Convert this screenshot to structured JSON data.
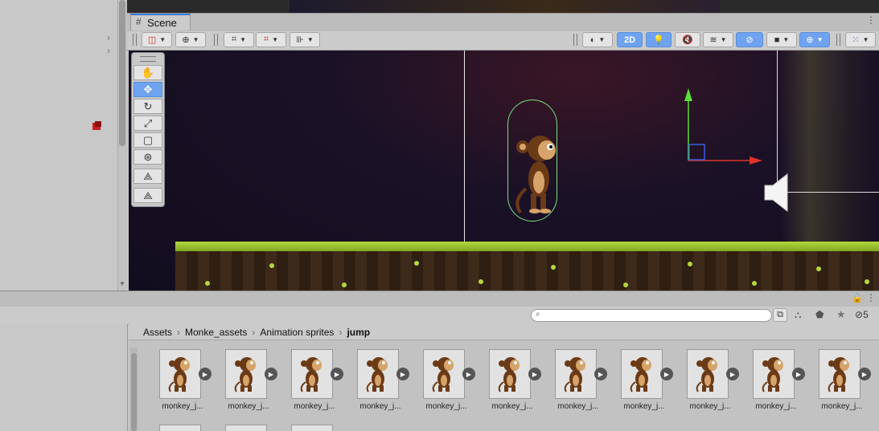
{
  "scene_tab": {
    "label": "Scene",
    "icon": "grid-icon"
  },
  "scene_toolbar": {
    "toggle_2d_label": "2D",
    "hidden_count": "5"
  },
  "project": {
    "search": {
      "placeholder": "",
      "value": ""
    },
    "breadcrumb": [
      "Assets",
      "Monke_assets",
      "Animation sprites",
      "jump"
    ],
    "hidden_count": "5",
    "assets": [
      {
        "label": "monkey_j..."
      },
      {
        "label": "monkey_j..."
      },
      {
        "label": "monkey_j..."
      },
      {
        "label": "monkey_j..."
      },
      {
        "label": "monkey_j..."
      },
      {
        "label": "monkey_j..."
      },
      {
        "label": "monkey_j..."
      },
      {
        "label": "monkey_j..."
      },
      {
        "label": "monkey_j..."
      },
      {
        "label": "monkey_j..."
      },
      {
        "label": "monkey_j..."
      }
    ]
  },
  "colors": {
    "accent": "#6fa3f0",
    "collider": "#7de07d",
    "gizmo_y": "#5ddc3a",
    "gizmo_x": "#e0342a",
    "gizmo_z": "#3a5ee0"
  }
}
